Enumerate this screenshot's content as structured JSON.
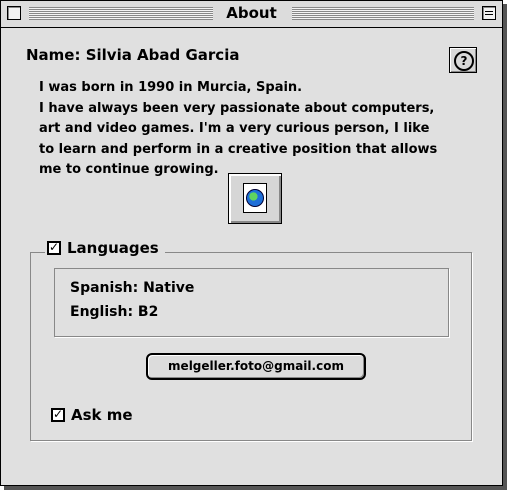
{
  "window": {
    "title": "About"
  },
  "profile": {
    "name_line": "Name: Silvia Abad Garcia",
    "bio": [
      "I was born in 1990 in Murcia, Spain.",
      "I have always been very passionate about computers,",
      "art and video games.  I'm a very curious person, I like",
      "to learn and perform in a creative position that allows",
      "me to continue growing."
    ]
  },
  "help": {
    "label": "?"
  },
  "languages": {
    "label": "Languages",
    "checked": true,
    "items": [
      "Spanish: Native",
      "English: B2"
    ]
  },
  "email": {
    "label": "melgeller.foto@gmail.com"
  },
  "ask_me": {
    "label": "Ask me",
    "checked": true
  },
  "icons": {
    "close": "close-box-icon",
    "zoom": "zoom-box-icon",
    "help": "help-icon",
    "document": "document-globe-icon"
  }
}
